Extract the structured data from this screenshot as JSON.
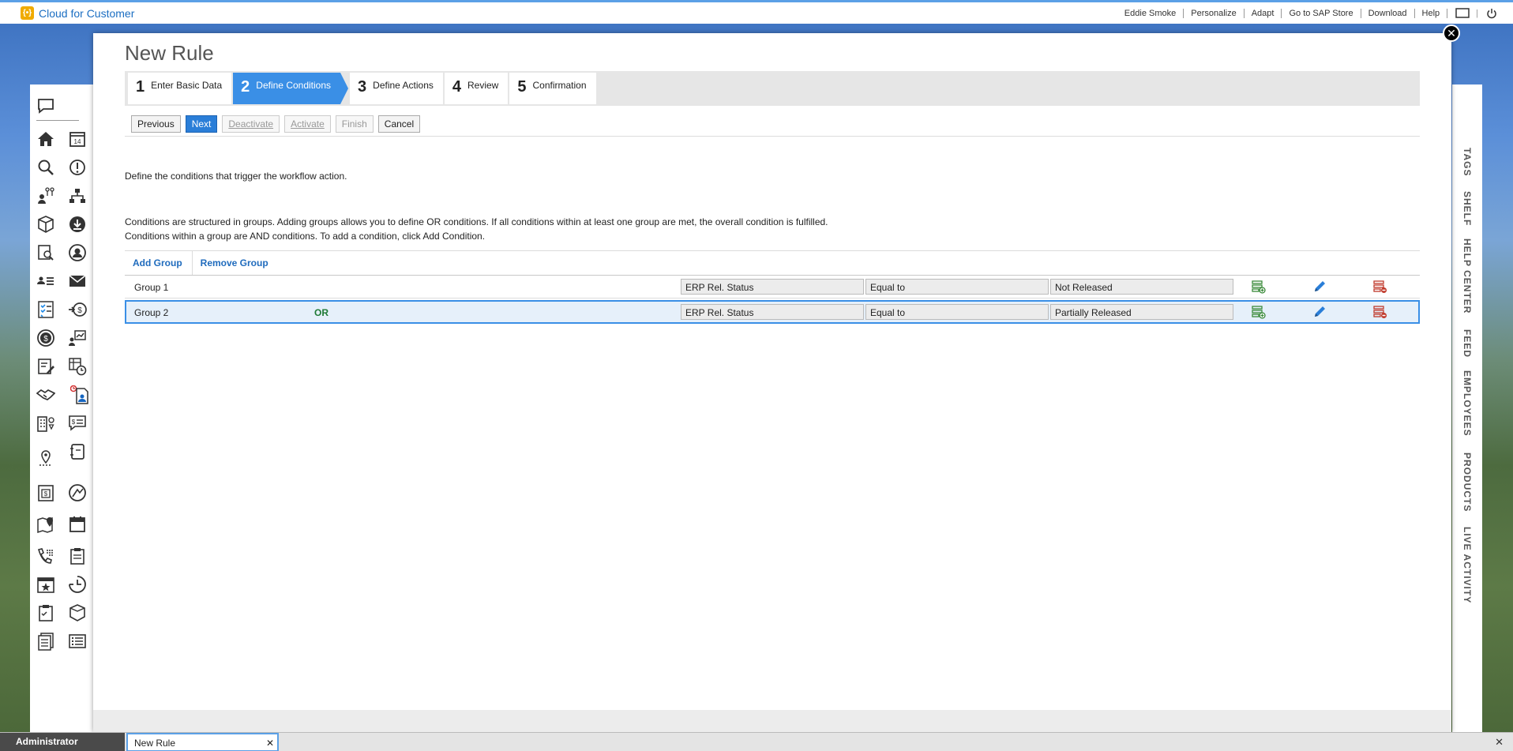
{
  "app": {
    "title": "Cloud for Customer",
    "logo_glyph": "{•}"
  },
  "top_links": [
    "Eddie Smoke",
    "Personalize",
    "Adapt",
    "Go to SAP Store",
    "Download",
    "Help"
  ],
  "top_icons": [
    "window-icon",
    "power-icon"
  ],
  "dialog": {
    "title": "New Rule",
    "close_glyph": "✕",
    "steps": [
      {
        "num": "1",
        "label": "Enter Basic Data",
        "active": false
      },
      {
        "num": "2",
        "label": "Define Conditions",
        "active": true
      },
      {
        "num": "3",
        "label": "Define Actions",
        "active": false
      },
      {
        "num": "4",
        "label": "Review",
        "active": false
      },
      {
        "num": "5",
        "label": "Confirmation",
        "active": false
      }
    ],
    "toolbar": {
      "previous": "Previous",
      "next": "Next",
      "deactivate": "Deactivate",
      "activate": "Activate",
      "finish": "Finish",
      "cancel": "Cancel"
    },
    "intro_text": "Define the conditions that trigger the workflow action.",
    "help_line1": "Conditions are structured in groups. Adding groups allows you to define OR conditions. If all conditions within at least one group are met, the overall condition is fulfilled.",
    "help_line2": "Conditions within a group are AND conditions. To add a condition, click Add Condition.",
    "group_actions": {
      "add_group": "Add Group",
      "remove_group": "Remove Group"
    },
    "groups": [
      {
        "name": "Group 1",
        "or_label": "",
        "field": "ERP Rel. Status",
        "operator": "Equal to",
        "value": "Not Released",
        "selected": false
      },
      {
        "name": "Group 2",
        "or_label": "OR",
        "field": "ERP Rel. Status",
        "operator": "Equal to",
        "value": "Partially Released",
        "selected": true
      }
    ]
  },
  "right_panel_tabs": [
    "TAGS",
    "SHELF",
    "HELP CENTER",
    "FEED",
    "EMPLOYEES",
    "PRODUCTS",
    "LIVE ACTIVITY"
  ],
  "taskbar": {
    "user": "Administrator",
    "open_tab": "New Rule",
    "tab_close_glyph": "✕",
    "close_all_glyph": "✕"
  },
  "colors": {
    "accent": "#3a8fe6",
    "link": "#1f6bbd",
    "or_green": "#1e7a35",
    "brand_logo": "#f0ab00"
  }
}
